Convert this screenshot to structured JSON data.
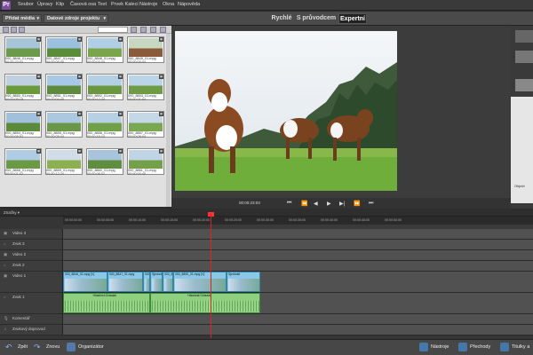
{
  "app": {
    "logo": "Pr"
  },
  "menubar": {
    "items": [
      "Soubor",
      "Úpravy",
      "Klip",
      "Časová osa",
      "Text",
      "Prvek Kaleci",
      "Nástroje",
      "Okna",
      "Nápověda"
    ]
  },
  "toolbar2": {
    "add_media": "Přidat média",
    "project_assets": "Datové zdroje projektu",
    "modes": [
      "Rychlé",
      "S průvodcem",
      "Expertní"
    ]
  },
  "media": {
    "items": [
      {
        "name": "000_8846_01.mpg",
        "duration": "00:00:22:04"
      },
      {
        "name": "000_8847_01.mpg",
        "duration": "00:00:09:06"
      },
      {
        "name": "000_8848_01.mpg",
        "duration": "00:00:03:04"
      },
      {
        "name": "000_8849_01.mpg",
        "duration": "00:00:05:04"
      },
      {
        "name": "000_8850_01.mpg",
        "duration": "00:00:05:18"
      },
      {
        "name": "000_8851_01.mpg",
        "duration": "00:00:04:40"
      },
      {
        "name": "000_8852_01.mpg",
        "duration": "00:00:12:24"
      },
      {
        "name": "000_8853_01.mpg",
        "duration": "00:00:01:04"
      },
      {
        "name": "000_8854_01.mpg",
        "duration": "00:00:09:52"
      },
      {
        "name": "000_8855_01.mpg",
        "duration": "00:00:05:44"
      },
      {
        "name": "000_8856_01.mpg",
        "duration": "00:00:15:10"
      },
      {
        "name": "000_8857_01.mpg",
        "duration": "00:00:08:04"
      },
      {
        "name": "000_8858_01.mpg",
        "duration": "00:00:01:02"
      },
      {
        "name": "000_8859_01.mpg",
        "duration": "00:00:12:24"
      },
      {
        "name": "000_8860_01.mpg",
        "duration": "00:00:08:02"
      },
      {
        "name": "000_8861_01.mpg",
        "duration": "00:00:00:40"
      }
    ]
  },
  "preview": {
    "timecode": "00:00:23:03"
  },
  "timeline": {
    "markers_label": "Značky",
    "ruler": [
      "00:00:00:00",
      "00:00:05:00",
      "00:00:10:00",
      "00:00:15:00",
      "00:00:20:00",
      "00:00:25:00",
      "00:00:30:00",
      "00:00:35:00",
      "00:00:40:00",
      "00:00:45:00",
      "00:00:50:00"
    ],
    "tracks": [
      "Video 3",
      "Zvuk 3",
      "Video 2",
      "Zvuk 2",
      "Video 1",
      "Zvuk 1",
      "Komentář",
      "Zvukový doprovod"
    ],
    "video_clips": [
      "000_8846_01.mpg [V]",
      "000_8847_01.mpg",
      "000_8848",
      "Sjednotit",
      "000_8851",
      "000_8850_01.mpg [V]",
      "Sjednotit"
    ],
    "audio_clips": [
      "Hlasitost:Ovladač",
      "Hlasitost:Ovladač"
    ]
  },
  "bottombar": {
    "undo": "Zpět",
    "redo": "Znovu",
    "organizer": "Organizátor",
    "tools": "Nástroje",
    "transitions": "Přechody",
    "titles": "Titulky a"
  },
  "sidebar_right": {
    "label": "Objekt"
  }
}
